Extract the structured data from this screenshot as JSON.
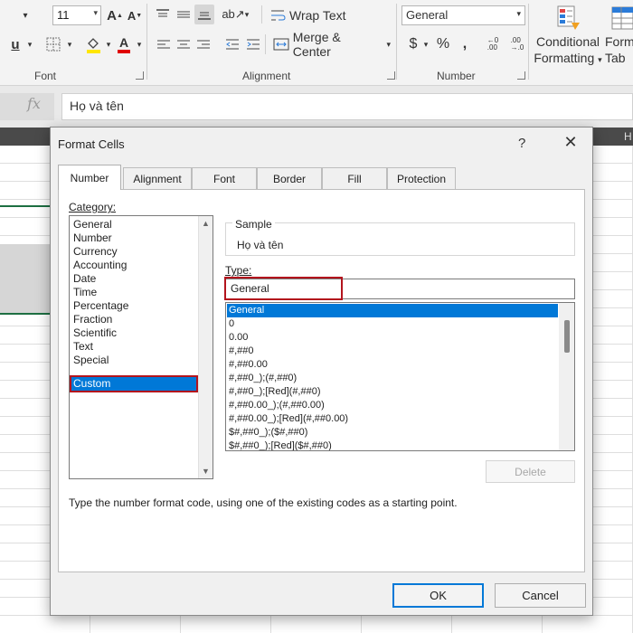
{
  "ribbon": {
    "font_size": "11",
    "number_format": "General",
    "groups": {
      "font": "Font",
      "alignment": "Alignment",
      "number": "Number"
    },
    "wrap_text": "Wrap Text",
    "merge_center": "Merge & Center",
    "conditional_formatting_line1": "Conditional",
    "conditional_formatting_line2": "Formatting",
    "format_as_table_line1": "Form",
    "format_as_table_line2": "Tab",
    "currency_symbol": "$",
    "percent_symbol": "%",
    "comma_symbol": ","
  },
  "formula_bar": {
    "fx": "fx",
    "value": "Họ và tên"
  },
  "sheet": {
    "column_header_fragment": "H"
  },
  "dialog": {
    "title": "Format Cells",
    "help": "?",
    "close": "✕",
    "tabs": [
      "Number",
      "Alignment",
      "Font",
      "Border",
      "Fill",
      "Protection"
    ],
    "category_label": "Category:",
    "categories": [
      "General",
      "Number",
      "Currency",
      "Accounting",
      "Date",
      "Time",
      "Percentage",
      "Fraction",
      "Scientific",
      "Text",
      "Special",
      "Custom"
    ],
    "selected_category": "Custom",
    "sample_label": "Sample",
    "sample_value": "Họ và tên",
    "type_label": "Type:",
    "type_value": "General",
    "type_list": [
      "General",
      "0",
      "0.00",
      "#,##0",
      "#,##0.00",
      "#,##0_);(#,##0)",
      "#,##0_);[Red](#,##0)",
      "#,##0.00_);(#,##0.00)",
      "#,##0.00_);[Red](#,##0.00)",
      "$#,##0_);($#,##0)",
      "$#,##0_);[Red]($#,##0)"
    ],
    "delete_label": "Delete",
    "hint": "Type the number format code, using one of the existing codes as a starting point.",
    "ok_label": "OK",
    "cancel_label": "Cancel"
  },
  "colors": {
    "accent": "#0078d7",
    "highlight_red": "#b3141d",
    "excel_green": "#1d6f42"
  }
}
